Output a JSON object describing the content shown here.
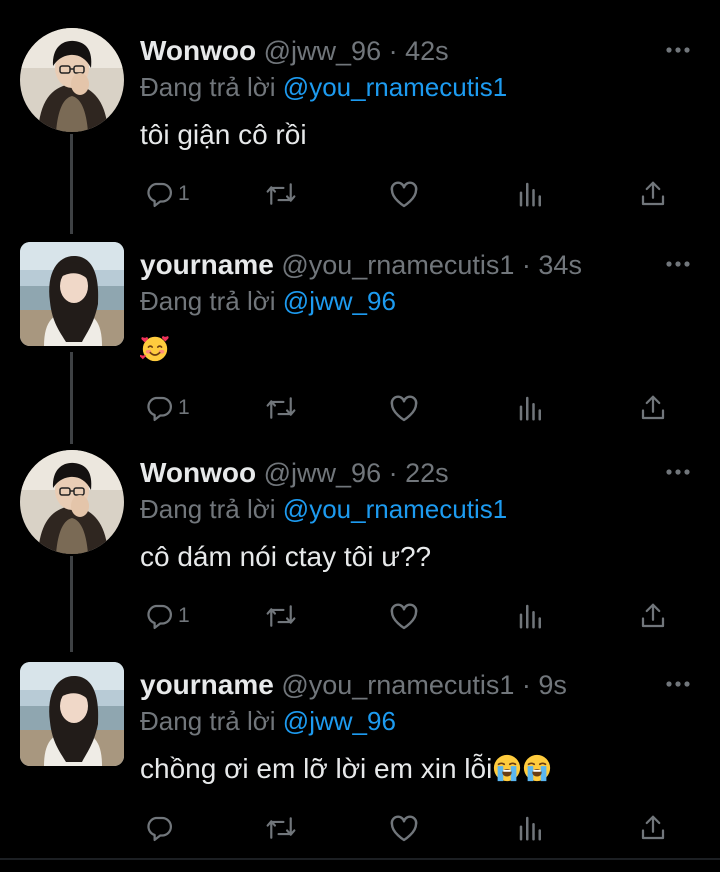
{
  "colors": {
    "background": "#000000",
    "text": "#e7e9ea",
    "secondary": "#71767b",
    "link": "#1d9bf0",
    "thread_line": "#3e4144"
  },
  "replying_label": "Đang trả lời",
  "tweets": [
    {
      "name": "Wonwoo",
      "handle": "@jww_96",
      "dot": "·",
      "time": "42s",
      "replying_to": "@you_rnamecutis1",
      "text": "tôi giận cô rồi",
      "emojis": [],
      "reply_count": "1",
      "avatar": "boy-avatar",
      "icons": [
        "reply-icon",
        "retweet-icon",
        "like-icon",
        "views-icon",
        "share-icon",
        "more-icon"
      ]
    },
    {
      "name": "yourname",
      "handle": "@you_rnamecutis1",
      "dot": "·",
      "time": "34s",
      "replying_to": "@jww_96",
      "text": "",
      "emojis": [
        "smiling-face-with-hearts"
      ],
      "reply_count": "1",
      "avatar": "girl-avatar",
      "icons": [
        "reply-icon",
        "retweet-icon",
        "like-icon",
        "views-icon",
        "share-icon",
        "more-icon"
      ]
    },
    {
      "name": "Wonwoo",
      "handle": "@jww_96",
      "dot": "·",
      "time": "22s",
      "replying_to": "@you_rnamecutis1",
      "text": "cô dám nói ctay tôi ư??",
      "emojis": [],
      "reply_count": "1",
      "avatar": "boy-avatar",
      "icons": [
        "reply-icon",
        "retweet-icon",
        "like-icon",
        "views-icon",
        "share-icon",
        "more-icon"
      ]
    },
    {
      "name": "yourname",
      "handle": "@you_rnamecutis1",
      "dot": "·",
      "time": "9s",
      "replying_to": "@jww_96",
      "text": "chồng ơi em lỡ lời em xin lỗi",
      "emojis": [
        "loudly-crying-face",
        "loudly-crying-face"
      ],
      "reply_count": "",
      "avatar": "girl-avatar",
      "icons": [
        "reply-icon",
        "retweet-icon",
        "like-icon",
        "views-icon",
        "share-icon",
        "more-icon"
      ]
    }
  ]
}
